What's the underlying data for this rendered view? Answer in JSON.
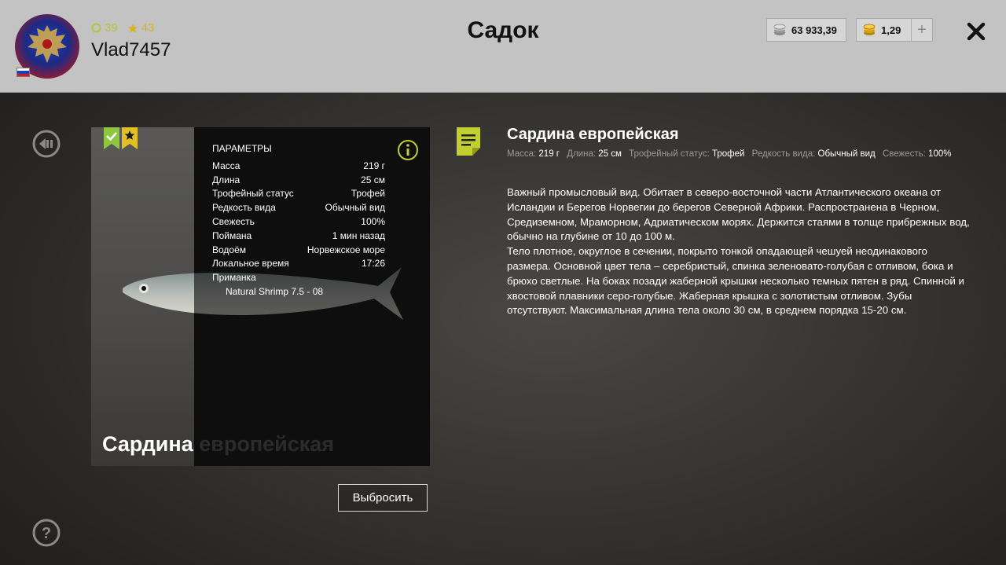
{
  "header": {
    "title": "Садок",
    "username": "Vlad7457",
    "level": "39",
    "stars": "43",
    "silver": "63 933,39",
    "gold": "1,29",
    "plus_label": "+"
  },
  "card": {
    "params_title": "ПАРАМЕТРЫ",
    "rows": [
      {
        "label": "Масса",
        "value": "219 г"
      },
      {
        "label": "Длина",
        "value": "25 см"
      },
      {
        "label": "Трофейный статус",
        "value": "Трофей"
      },
      {
        "label": "Редкость вида",
        "value": "Обычный вид"
      },
      {
        "label": "Свежесть",
        "value": "100%"
      },
      {
        "label": "Поймана",
        "value": "1 мин назад"
      },
      {
        "label": "Водоём",
        "value": "Норвежское море"
      },
      {
        "label": "Локальное время",
        "value": "17:26"
      }
    ],
    "bait_label": "Приманка",
    "bait_value": "Natural Shrimp 7.5 - 08",
    "name_part1": "Сардина",
    "name_part2": " европейская"
  },
  "discard_label": "Выбросить",
  "details": {
    "title": "Сардина европейская",
    "stats": [
      {
        "k": "Масса:",
        "v": "219 г"
      },
      {
        "k": "Длина:",
        "v": "25 см"
      },
      {
        "k": "Трофейный статус:",
        "v": "Трофей"
      },
      {
        "k": "Редкость вида:",
        "v": "Обычный вид"
      },
      {
        "k": "Свежесть:",
        "v": "100%"
      }
    ],
    "description": "Важный промысловый вид. Обитает в северо-восточной части Атлантического океана от Исландии и Берегов Норвегии до берегов Северной Африки. Распространена в Черном, Средиземном, Мраморном, Адриатическом морях. Держится стаями в толще прибрежных вод, обычно на глубине от 10 до 100 м.\nТело плотное, округлое в сечении, покрыто тонкой опадающей чешуей неодинакового размера. Основной цвет тела – серебристый, спинка зеленовато-голубая с отливом, бока и брюхо светлые. На боках позади жаберной крышки несколько темных пятен в ряд. Спинной и хвостовой плавники серо-голубые. Жаберная крышка с золотистым отливом. Зубы отсутствуют. Максимальная длина тела около 30 см, в среднем порядка 15-20 см."
  },
  "colors": {
    "accent": "#c3cf2c",
    "star": "#e0c022",
    "header_bg": "#c3c3c3"
  },
  "icons": [
    "avatar-eagle-icon",
    "level-icon",
    "star-icon",
    "silver-coin-icon",
    "gold-coin-icon",
    "plus-icon",
    "close-icon",
    "back-icon",
    "help-icon",
    "check-badge-icon",
    "star-badge-icon",
    "info-icon",
    "document-icon"
  ]
}
